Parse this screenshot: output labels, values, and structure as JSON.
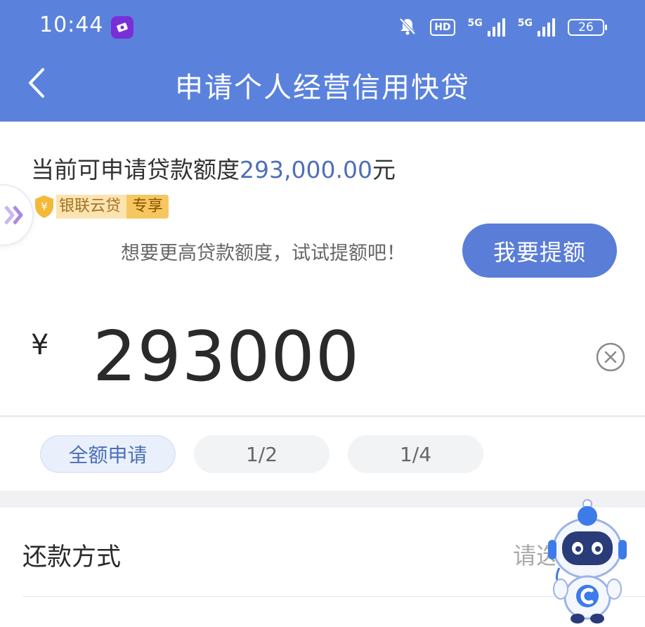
{
  "status_bar": {
    "time": "10:44",
    "hd_label": "HD",
    "net1_label": "5G",
    "net2_label": "5G",
    "battery_level": "26",
    "colors": {
      "app_icon": "#7a2fd6"
    }
  },
  "header": {
    "title": "申请个人经营信用快贷",
    "background_color": "#5a82dd"
  },
  "limit": {
    "prefix": "当前可申请贷款额度",
    "amount": "293,000.00",
    "suffix": "元"
  },
  "tags": {
    "brand": "银联云贷",
    "exclusive": "专享"
  },
  "upgrade": {
    "hint": "想要更高贷款额度，试试提额吧！",
    "button_label": "我要提额"
  },
  "amount_input": {
    "currency": "¥",
    "value": "293000"
  },
  "amount_options": [
    {
      "label": "全额申请",
      "selected": true
    },
    {
      "label": "1/2",
      "selected": false
    },
    {
      "label": "1/4",
      "selected": false
    }
  ],
  "repayment": {
    "label": "还款方式",
    "placeholder": "请选"
  },
  "icons": {
    "back": "chevron-left-icon",
    "mute": "bell-off-icon",
    "clear": "close-circle-icon",
    "shield": "shield-yuan-icon",
    "float": "double-chevron-right-icon",
    "assistant": "robot-assistant-icon"
  },
  "accent_color": "#5a7dd7"
}
